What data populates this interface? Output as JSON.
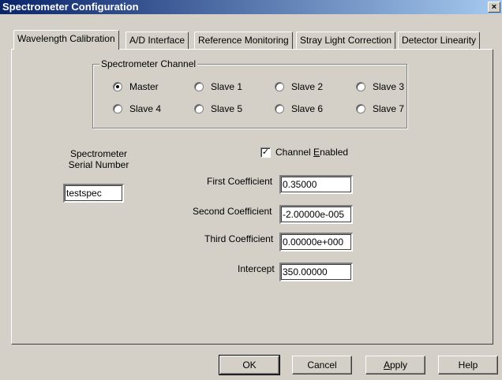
{
  "window": {
    "title": "Spectrometer Configuration",
    "close_glyph": "×"
  },
  "tabs": [
    {
      "label": "Wavelength Calibration",
      "active": true
    },
    {
      "label": "A/D Interface",
      "active": false
    },
    {
      "label": "Reference Monitoring",
      "active": false
    },
    {
      "label": "Stray Light Correction",
      "active": false
    },
    {
      "label": "Detector Linearity",
      "active": false
    }
  ],
  "channel_group": {
    "legend": "Spectrometer Channel",
    "selected": "Master",
    "options": [
      "Master",
      "Slave 1",
      "Slave 2",
      "Slave 3",
      "Slave 4",
      "Slave 5",
      "Slave 6",
      "Slave 7"
    ]
  },
  "serial": {
    "label_line1": "Spectrometer",
    "label_line2": "Serial Number",
    "value": "testspec"
  },
  "channel_enabled": {
    "label_pre": "Channel ",
    "label_underline": "E",
    "label_post": "nabled",
    "checked": true,
    "check_glyph": "✓"
  },
  "coefficients": {
    "first_label": "First Coefficient",
    "first_value": "0.35000",
    "second_label": "Second Coefficient",
    "second_value": "-2.00000e-005",
    "third_label": "Third Coefficient",
    "third_value": "0.00000e+000",
    "intercept_label": "Intercept",
    "intercept_value": "350.00000"
  },
  "buttons": {
    "ok": "OK",
    "cancel": "Cancel",
    "apply_underline": "A",
    "apply_rest": "pply",
    "help": "Help"
  }
}
